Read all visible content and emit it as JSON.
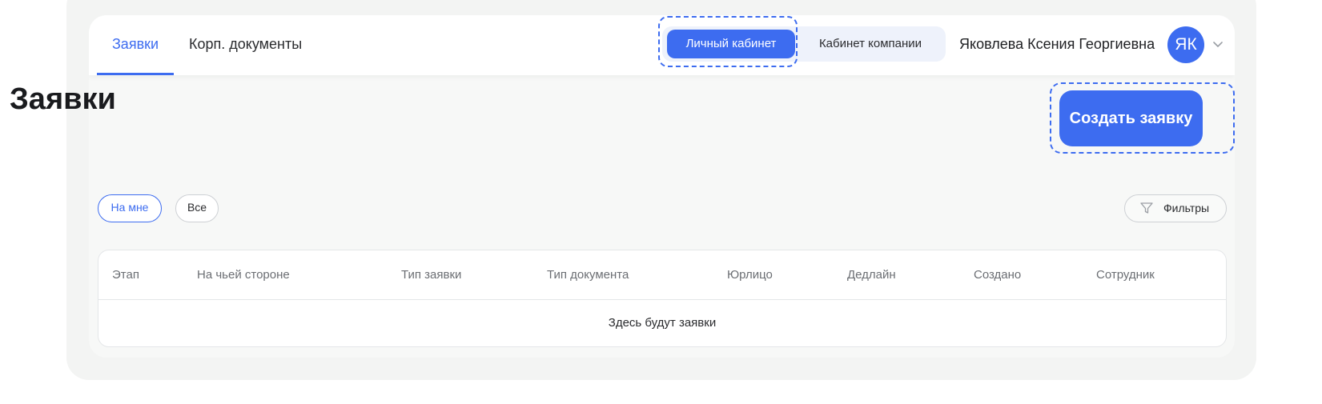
{
  "header": {
    "tabs": [
      {
        "label": "Заявки",
        "active": true
      },
      {
        "label": "Корп. документы",
        "active": false
      }
    ],
    "cabinet_switch": {
      "personal_label": "Личный кабинет",
      "company_label": "Кабинет компании",
      "selected": "personal"
    },
    "user": {
      "name": "Яковлева Ксения Георгиевна",
      "initials": "ЯК"
    }
  },
  "main": {
    "title": "Заявки",
    "create_button_label": "Создать заявку",
    "chips": [
      {
        "label": "На мне",
        "selected": true
      },
      {
        "label": "Все",
        "selected": false
      }
    ],
    "filters_label": "Фильтры",
    "table": {
      "columns": [
        "Этап",
        "На чьей стороне",
        "Тип заявки",
        "Тип документа",
        "Юрлицо",
        "Дедлайн",
        "Создано",
        "Сотрудник"
      ],
      "empty_text": "Здесь будут заявки"
    }
  },
  "colors": {
    "accent": "#3d6cf0"
  },
  "icons": {
    "filter": "filter-funnel-icon",
    "user_menu": "chevron-down-icon"
  }
}
